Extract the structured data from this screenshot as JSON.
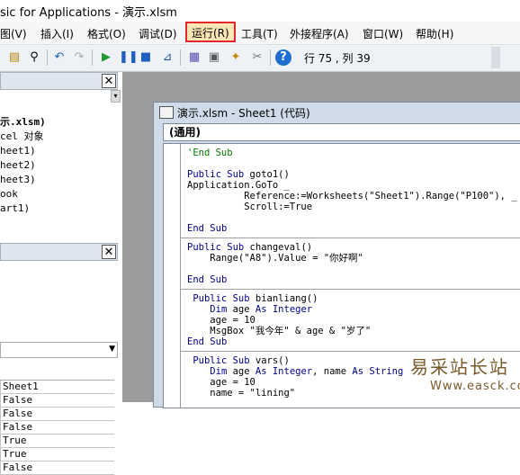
{
  "window": {
    "title": "sic for Applications - 演示.xlsm"
  },
  "menu": [
    "图(V)",
    "插入(I)",
    "格式(O)",
    "调试(D)",
    "运行(R)",
    "工具(T)",
    "外接程序(A)",
    "窗口(W)",
    "帮助(H)"
  ],
  "toolbar": {
    "status": "行 75 , 列 39"
  },
  "project_tree": [
    "示.xlsm)",
    "cel 对象",
    "heet1)",
    "heet2)",
    "heet3)",
    "ook",
    "art1)"
  ],
  "properties": [
    "Sheet1",
    "False",
    "False",
    "False",
    "True",
    "True",
    "False"
  ],
  "code_window": {
    "title": "演示.xlsm - Sheet1 (代码)",
    "object_box": "(通用)",
    "lines": [
      "'End Sub",
      "",
      "Public Sub goto1()",
      "Application.GoTo _",
      "          Reference:=Worksheets(\"Sheet1\").Range(\"P100\"), _",
      "          Scroll:=True",
      "",
      "End Sub",
      "---",
      "Public Sub changeval()",
      "    Range(\"A8\").Value = \"你好啊\"",
      "",
      "End Sub",
      "---",
      " Public Sub bianliang()",
      "    Dim age As Integer",
      "    age = 10",
      "    MsgBox \"我今年\" & age & \"岁了\"",
      "End Sub",
      "---",
      " Public Sub vars()",
      "    Dim age As Integer, name As String",
      "    age = 10",
      "    name = \"lining\""
    ]
  },
  "watermark": {
    "cn": "易采站长站",
    "en": "Www.easck.com"
  }
}
